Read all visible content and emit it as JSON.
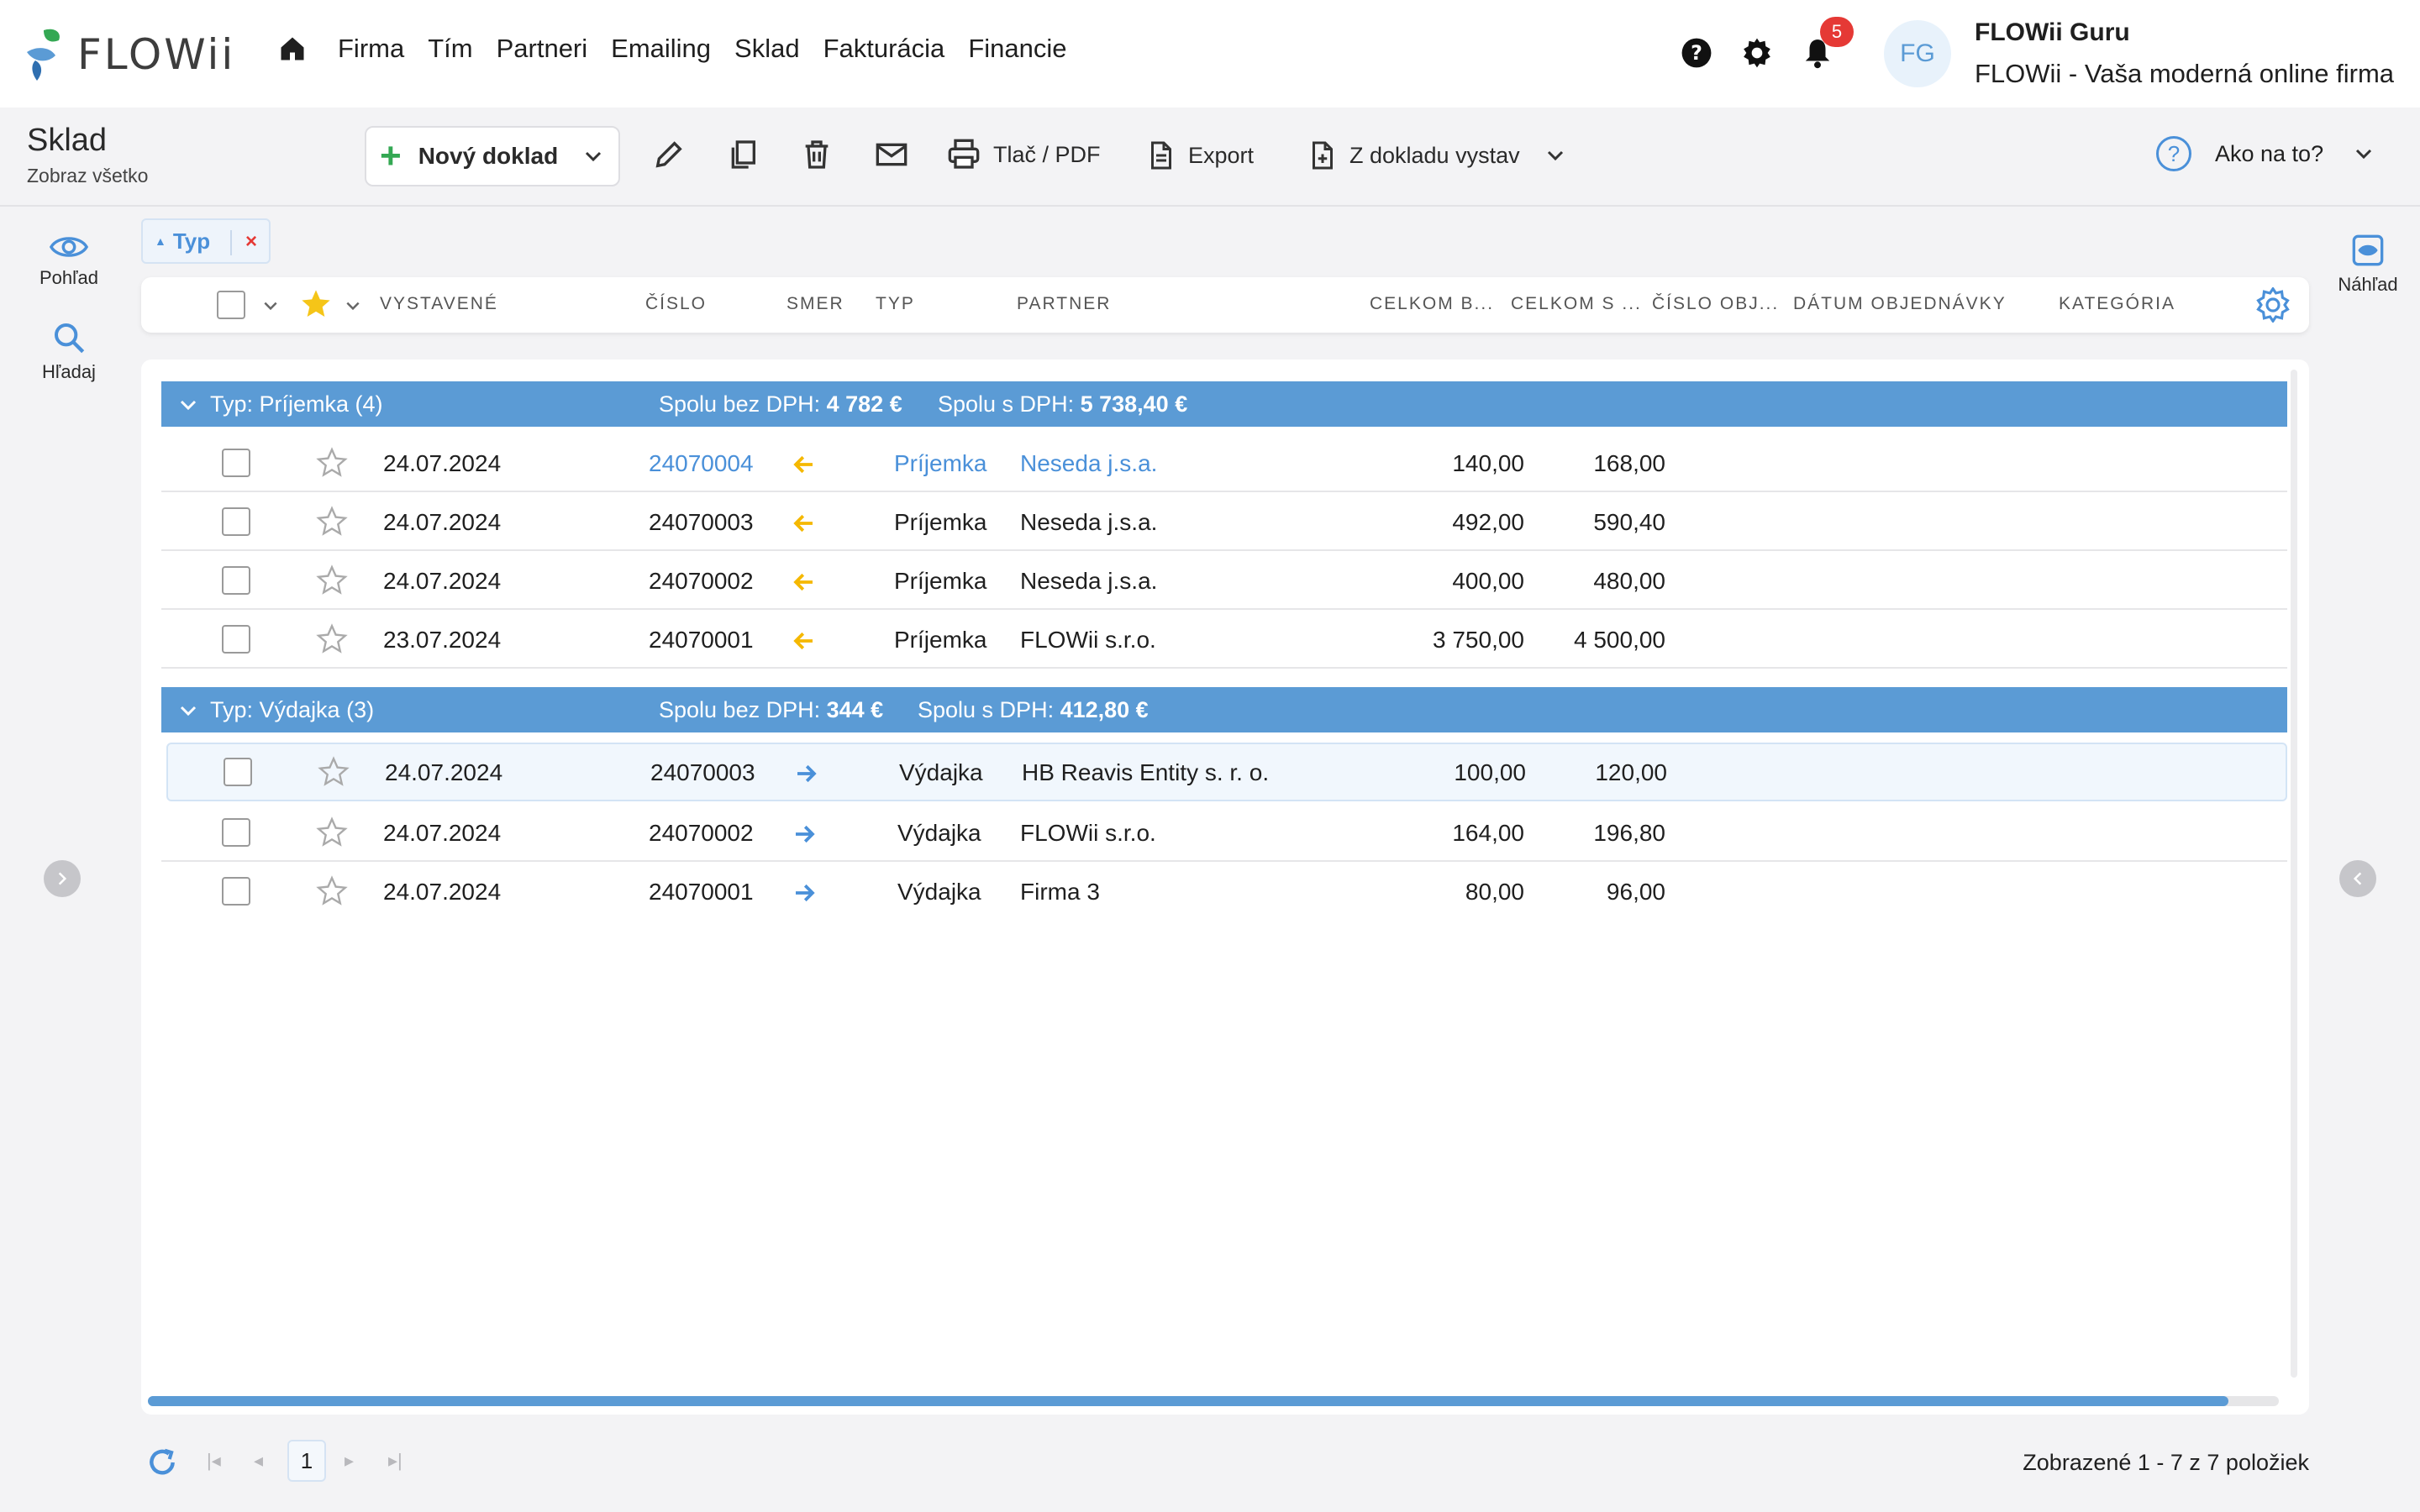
{
  "app": {
    "logo_text": "FLOWii",
    "nav": [
      "Firma",
      "Tím",
      "Partneri",
      "Emailing",
      "Sklad",
      "Fakturácia",
      "Financie"
    ],
    "notifications_count": "5",
    "avatar_initials": "FG",
    "user_name": "FLOWii Guru",
    "company": "FLOWii - Vaša moderná online firma",
    "colors": {
      "accent": "#5b9bd5",
      "link": "#4a90d9",
      "badge": "#e53935",
      "plus": "#34a853",
      "arrow_in": "#f5b800",
      "arrow_out": "#4a90d9"
    }
  },
  "toolbar": {
    "title": "Sklad",
    "subtitle": "Zobraz všetko",
    "new_doc": "Nový doklad",
    "print": "Tlač / PDF",
    "export": "Export",
    "from_doc": "Z dokladu vystav",
    "help": "Ako na to?",
    "icons": [
      "plus-icon",
      "pencil-icon",
      "copy-icon",
      "trash-icon",
      "mail-icon",
      "printer-icon",
      "document-icon",
      "document-plus-icon",
      "question-icon"
    ]
  },
  "rail": {
    "view": "Pohľad",
    "search": "Hľadaj",
    "preview": "Náhľad"
  },
  "filter_chip": {
    "label": "Typ"
  },
  "columns": [
    "VYSTAVENÉ",
    "ČÍSLO",
    "SMER",
    "TYP",
    "PARTNER",
    "CELKOM B...",
    "CELKOM S ...",
    "ČÍSLO OBJ...",
    "DÁTUM OBJEDNÁVKY",
    "KATEGÓRIA"
  ],
  "groups": [
    {
      "title": "Typ: Príjemka (4)",
      "sum_without_label": "Spolu bez DPH:",
      "sum_without": "4 782 €",
      "sum_with_label": "Spolu s DPH:",
      "sum_with": "5 738,40 €",
      "rows": [
        {
          "date": "24.07.2024",
          "number": "24070004",
          "direction": "in",
          "type": "Príjemka",
          "partner": "Neseda j.s.a.",
          "total_without": "140,00",
          "total_with": "168,00",
          "link": true
        },
        {
          "date": "24.07.2024",
          "number": "24070003",
          "direction": "in",
          "type": "Príjemka",
          "partner": "Neseda j.s.a.",
          "total_without": "492,00",
          "total_with": "590,40",
          "link": false
        },
        {
          "date": "24.07.2024",
          "number": "24070002",
          "direction": "in",
          "type": "Príjemka",
          "partner": "Neseda j.s.a.",
          "total_without": "400,00",
          "total_with": "480,00",
          "link": false
        },
        {
          "date": "23.07.2024",
          "number": "24070001",
          "direction": "in",
          "type": "Príjemka",
          "partner": "FLOWii s.r.o.",
          "total_without": "3 750,00",
          "total_with": "4 500,00",
          "link": false
        }
      ]
    },
    {
      "title": "Typ: Výdajka (3)",
      "sum_without_label": "Spolu bez DPH:",
      "sum_without": "344 €",
      "sum_with_label": "Spolu s DPH:",
      "sum_with": "412,80 €",
      "rows": [
        {
          "date": "24.07.2024",
          "number": "24070003",
          "direction": "out",
          "type": "Výdajka",
          "partner": "HB Reavis Entity s. r. o.",
          "total_without": "100,00",
          "total_with": "120,00",
          "link": false,
          "selected": true
        },
        {
          "date": "24.07.2024",
          "number": "24070002",
          "direction": "out",
          "type": "Výdajka",
          "partner": "FLOWii s.r.o.",
          "total_without": "164,00",
          "total_with": "196,80",
          "link": false
        },
        {
          "date": "24.07.2024",
          "number": "24070001",
          "direction": "out",
          "type": "Výdajka",
          "partner": "Firma 3",
          "total_without": "80,00",
          "total_with": "96,00",
          "link": false
        }
      ]
    }
  ],
  "pager": {
    "current_page": "1",
    "info": "Zobrazené 1 - 7 z 7 položiek"
  }
}
